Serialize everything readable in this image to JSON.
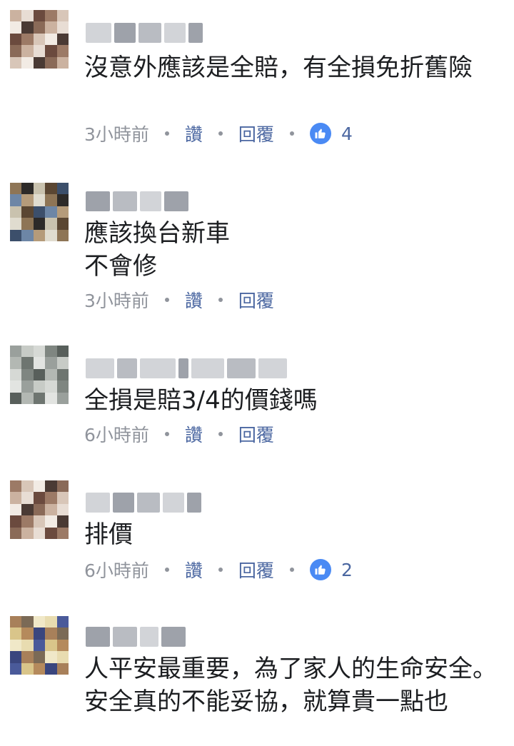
{
  "comments": [
    {
      "text": "沒意外應該是全賠，有全損免折舊險",
      "time": "3小時前",
      "like_label": "讚",
      "reply_label": "回覆",
      "reactions": "4"
    },
    {
      "text": "應該換台新車\n不會修",
      "time": "3小時前",
      "like_label": "讚",
      "reply_label": "回覆"
    },
    {
      "text": "全損是賠3/4的價錢嗎",
      "time": "6小時前",
      "like_label": "讚",
      "reply_label": "回覆"
    },
    {
      "text": "排價",
      "time": "6小時前",
      "like_label": "讚",
      "reply_label": "回覆",
      "reactions": "2"
    },
    {
      "text": "人平安最重要，為了家人的生命安全。\n安全真的不能妥協，就算貴一點也"
    }
  ],
  "icons": {
    "like_badge": "thumbs-up-icon",
    "like_color": "#4a8af4",
    "link_color": "#4b67a1",
    "meta_color": "#90949c"
  }
}
